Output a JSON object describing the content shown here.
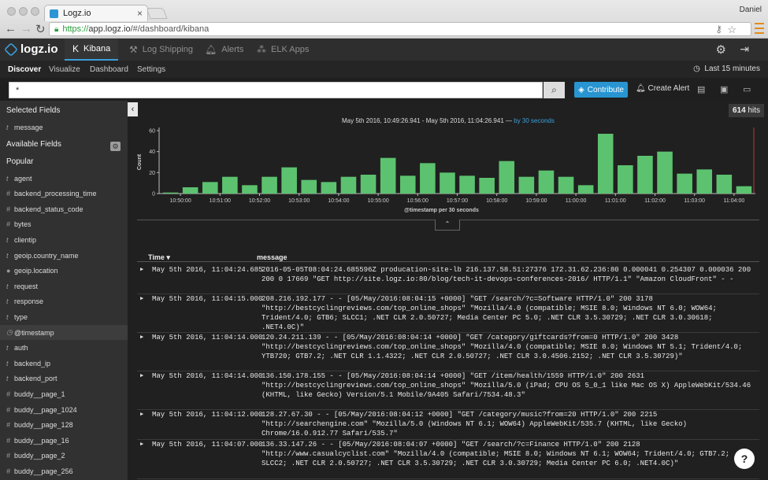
{
  "browser": {
    "tab_title": "Logz.io",
    "user": "Daniel",
    "url_scheme": "https://",
    "url_host": "app.logz.io",
    "url_path": "/#/dashboard/kibana"
  },
  "header": {
    "logo": "logz.io",
    "nav": [
      {
        "label": "Kibana",
        "icon": "kibana-icon",
        "active": true
      },
      {
        "label": "Log Shipping",
        "icon": "ship-icon"
      },
      {
        "label": "Alerts",
        "icon": "bell-icon"
      },
      {
        "label": "ELK Apps",
        "icon": "apps-icon"
      }
    ]
  },
  "subnav": {
    "items": [
      "Discover",
      "Visualize",
      "Dashboard",
      "Settings"
    ],
    "time_range": "Last 15 minutes"
  },
  "search": {
    "query": "*",
    "contribute_label": "Contribute",
    "create_alert_label": "Create Alert"
  },
  "sidebar": {
    "selected_heading": "Selected Fields",
    "selected_fields": [
      {
        "type": "t",
        "name": "message"
      }
    ],
    "available_heading": "Available Fields",
    "popular_heading": "Popular",
    "fields": [
      {
        "type": "t",
        "name": "agent"
      },
      {
        "type": "#",
        "name": "backend_processing_time"
      },
      {
        "type": "#",
        "name": "backend_status_code"
      },
      {
        "type": "#",
        "name": "bytes"
      },
      {
        "type": "t",
        "name": "clientip"
      },
      {
        "type": "t",
        "name": "geoip.country_name"
      },
      {
        "type": "●",
        "name": "geoip.location"
      },
      {
        "type": "t",
        "name": "request"
      },
      {
        "type": "t",
        "name": "response"
      },
      {
        "type": "t",
        "name": "type"
      },
      {
        "type": "◷",
        "name": "@timestamp"
      },
      {
        "type": "t",
        "name": "auth"
      },
      {
        "type": "t",
        "name": "backend_ip"
      },
      {
        "type": "t",
        "name": "backend_port"
      },
      {
        "type": "#",
        "name": "buddy__page_1"
      },
      {
        "type": "#",
        "name": "buddy__page_1024"
      },
      {
        "type": "#",
        "name": "buddy__page_128"
      },
      {
        "type": "#",
        "name": "buddy__page_16"
      },
      {
        "type": "#",
        "name": "buddy__page_2"
      },
      {
        "type": "#",
        "name": "buddy__page_256"
      }
    ]
  },
  "results": {
    "hits": "614",
    "hits_label": "hits",
    "range_text": "May 5th 2016, 10:49:26.941 - May 5th 2016, 11:04:26.941 —",
    "interval_text": "by 30 seconds",
    "columns": {
      "time": "Time",
      "message": "message"
    },
    "rows": [
      {
        "time": "May 5th 2016, 11:04:24.685",
        "message": "2016-05-05T08:04:24.685596Z producation-site-lb 216.137.58.51:27376 172.31.62.236:80 0.000041 0.254307 0.000036 200 200 0 17669 \"GET http://site.logz.io:80/blog/tech-it-devops-conferences-2016/ HTTP/1.1\" \"Amazon CloudFront\" - -"
      },
      {
        "time": "May 5th 2016, 11:04:15.000",
        "message": "208.216.192.177 - - [05/May/2016:08:04:15 +0000] \"GET /search/?c=Software HTTP/1.0\" 200 3178 \"http://bestcyclingreviews.com/top_online_shops\" \"Mozilla/4.0 (compatible; MSIE 8.0; Windows NT 6.0; WOW64; Trident/4.0; GTB6; SLCC1; .NET CLR 2.0.50727; Media Center PC 5.0; .NET CLR 3.5.30729; .NET CLR 3.0.30618; .NET4.0C)\""
      },
      {
        "time": "May 5th 2016, 11:04:14.000",
        "message": "120.24.211.139 - - [05/May/2016:08:04:14 +0000] \"GET /category/giftcards?from=0 HTTP/1.0\" 200 3428 \"http://bestcyclingreviews.com/top_online_shops\" \"Mozilla/4.0 (compatible; MSIE 8.0; Windows NT 5.1; Trident/4.0; YTB720; GTB7.2; .NET CLR 1.1.4322; .NET CLR 2.0.50727; .NET CLR 3.0.4506.2152; .NET CLR 3.5.30729)\""
      },
      {
        "time": "May 5th 2016, 11:04:14.000",
        "message": "136.150.178.155 - - [05/May/2016:08:04:14 +0000] \"GET /item/health/1559 HTTP/1.0\" 200 2631 \"http://bestcyclingreviews.com/top_online_shops\" \"Mozilla/5.0 (iPad; CPU OS 5_0_1 like Mac OS X) AppleWebKit/534.46 (KHTML, like Gecko) Version/5.1 Mobile/9A405 Safari/7534.48.3\""
      },
      {
        "time": "May 5th 2016, 11:04:12.000",
        "message": "128.27.67.30 - - [05/May/2016:08:04:12 +0000] \"GET /category/music?from=20 HTTP/1.0\" 200 2215 \"http://searchengine.com\" \"Mozilla/5.0 (Windows NT 6.1; WOW64) AppleWebKit/535.7 (KHTML, like Gecko) Chrome/16.0.912.77 Safari/535.7\""
      },
      {
        "time": "May 5th 2016, 11:04:07.000",
        "message": "136.33.147.26 - - [05/May/2016:08:04:07 +0000] \"GET /search/?c=Finance HTTP/1.0\" 200 2128 \"http://www.casualcyclist.com\" \"Mozilla/4.0 (compatible; MSIE 8.0; Windows NT 6.1; WOW64; Trident/4.0; GTB7.2; SLCC2; .NET CLR 2.0.50727; .NET CLR 3.5.30729; .NET CLR 3.0.30729; Media Center PC 6.0; .NET4.0C)\""
      }
    ]
  },
  "colors": {
    "accent": "#3aa0da",
    "bar": "#5cc26f",
    "contribute": "#2895d2"
  },
  "chart_data": {
    "type": "bar",
    "ylabel": "Count",
    "xlabel": "@timestamp per 30 seconds",
    "ylim": [
      0,
      60
    ],
    "yticks": [
      0,
      20,
      40,
      60
    ],
    "xtick_labels": [
      "10:50:00",
      "10:51:00",
      "10:52:00",
      "10:53:00",
      "10:54:00",
      "10:55:00",
      "10:56:00",
      "10:57:00",
      "10:58:00",
      "10:59:00",
      "11:00:00",
      "11:01:00",
      "11:02:00",
      "11:03:00",
      "11:04:00"
    ],
    "values": [
      1,
      6,
      11,
      16,
      8,
      16,
      25,
      13,
      11,
      16,
      18,
      34,
      17,
      29,
      20,
      17,
      15,
      31,
      16,
      22,
      16,
      8,
      57,
      27,
      36,
      40,
      19,
      23,
      18,
      7
    ]
  }
}
